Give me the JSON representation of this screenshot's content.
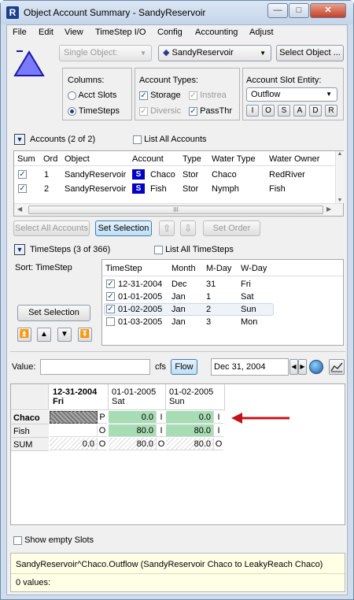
{
  "window": {
    "title": "Object Account Summary - SandyReservoir",
    "app_icon": "R",
    "minimize": "—",
    "maximize": "□",
    "close": "✕"
  },
  "menu": [
    "File",
    "Edit",
    "View",
    "TimeStep I/O",
    "Config",
    "Accounting",
    "Adjust"
  ],
  "top": {
    "single_object": "Single Object:",
    "object_name": "SandyReservoir",
    "select_object": "Select Object ..."
  },
  "columns": {
    "label": "Columns:",
    "acct_slots": "Acct Slots",
    "timesteps": "TimeSteps",
    "selected": "TimeSteps"
  },
  "account_types": {
    "label": "Account Types:",
    "storage": "Storage",
    "instream": "Instrea",
    "diversion": "Diversic",
    "passthru": "PassThr"
  },
  "slot_entity": {
    "label": "Account Slot Entity:",
    "value": "Outflow",
    "buttons": [
      "I",
      "O",
      "S",
      "A",
      "D",
      "R"
    ]
  },
  "accounts": {
    "header": "Accounts (2 of 2)",
    "list_all": "List All Accounts",
    "columns": [
      "Sum",
      "Ord",
      "Object",
      "Account",
      "Type",
      "Water Type",
      "Water Owner"
    ],
    "rows": [
      {
        "sum": true,
        "ord": "1",
        "object": "SandyReservoir",
        "badge": "S",
        "account": "Chaco",
        "type": "Stor",
        "water_type": "Chaco",
        "owner": "RedRiver"
      },
      {
        "sum": true,
        "ord": "2",
        "object": "SandyReservoir",
        "badge": "S",
        "account": "Fish",
        "type": "Stor",
        "water_type": "Nymph",
        "owner": "Fish"
      }
    ],
    "scroll_mid": "III"
  },
  "account_buttons": {
    "select_all": "Select All Accounts",
    "set_selection": "Set Selection",
    "set_order": "Set Order"
  },
  "timesteps": {
    "header": "TimeSteps (3 of 366)",
    "list_all": "List All TimeSteps",
    "sort": "Sort: TimeStep",
    "set_selection": "Set Selection",
    "columns": [
      "TimeStep",
      "Month",
      "M-Day",
      "W-Day"
    ],
    "rows": [
      {
        "checked": true,
        "date": "12-31-2004",
        "month": "Dec",
        "mday": "31",
        "wday": "Fri"
      },
      {
        "checked": true,
        "date": "01-01-2005",
        "month": "Jan",
        "mday": "1",
        "wday": "Sat"
      },
      {
        "checked": true,
        "date": "01-02-2005",
        "month": "Jan",
        "mday": "2",
        "wday": "Sun"
      },
      {
        "checked": false,
        "date": "01-03-2005",
        "month": "Jan",
        "mday": "3",
        "wday": "Mon"
      }
    ]
  },
  "value_bar": {
    "label": "Value:",
    "units": "cfs",
    "flow": "Flow",
    "date": "Dec 31, 2004"
  },
  "grid": {
    "columns": [
      {
        "date": "12-31-2004",
        "day": "Fri"
      },
      {
        "date": "01-01-2005",
        "day": "Sat"
      },
      {
        "date": "01-02-2005",
        "day": "Sun"
      }
    ],
    "rows": [
      {
        "label": "Chaco",
        "cells": [
          {
            "v": "",
            "f": "P"
          },
          {
            "v": "0.0",
            "f": "I"
          },
          {
            "v": "0.0",
            "f": "I"
          }
        ]
      },
      {
        "label": "Fish",
        "cells": [
          {
            "v": "",
            "f": "O"
          },
          {
            "v": "80.0",
            "f": "I"
          },
          {
            "v": "80.0",
            "f": "I"
          }
        ]
      },
      {
        "label": "SUM",
        "cells": [
          {
            "v": "0.0",
            "f": "O"
          },
          {
            "v": "80.0",
            "f": "O"
          },
          {
            "v": "80.0",
            "f": "O"
          }
        ]
      }
    ]
  },
  "show_empty": "Show empty Slots",
  "status": {
    "line1": "SandyReservoir^Chaco.Outflow (SandyReservoir Chaco to LeakyReach Chaco)",
    "line2": "0 values:"
  },
  "colors": {
    "accent_blue": "#1f3f7a",
    "badge_blue": "#0000c8",
    "green_cell": "#a8dcb4",
    "arrow_red": "#c0141a",
    "reservoir": "#7a7aff"
  }
}
